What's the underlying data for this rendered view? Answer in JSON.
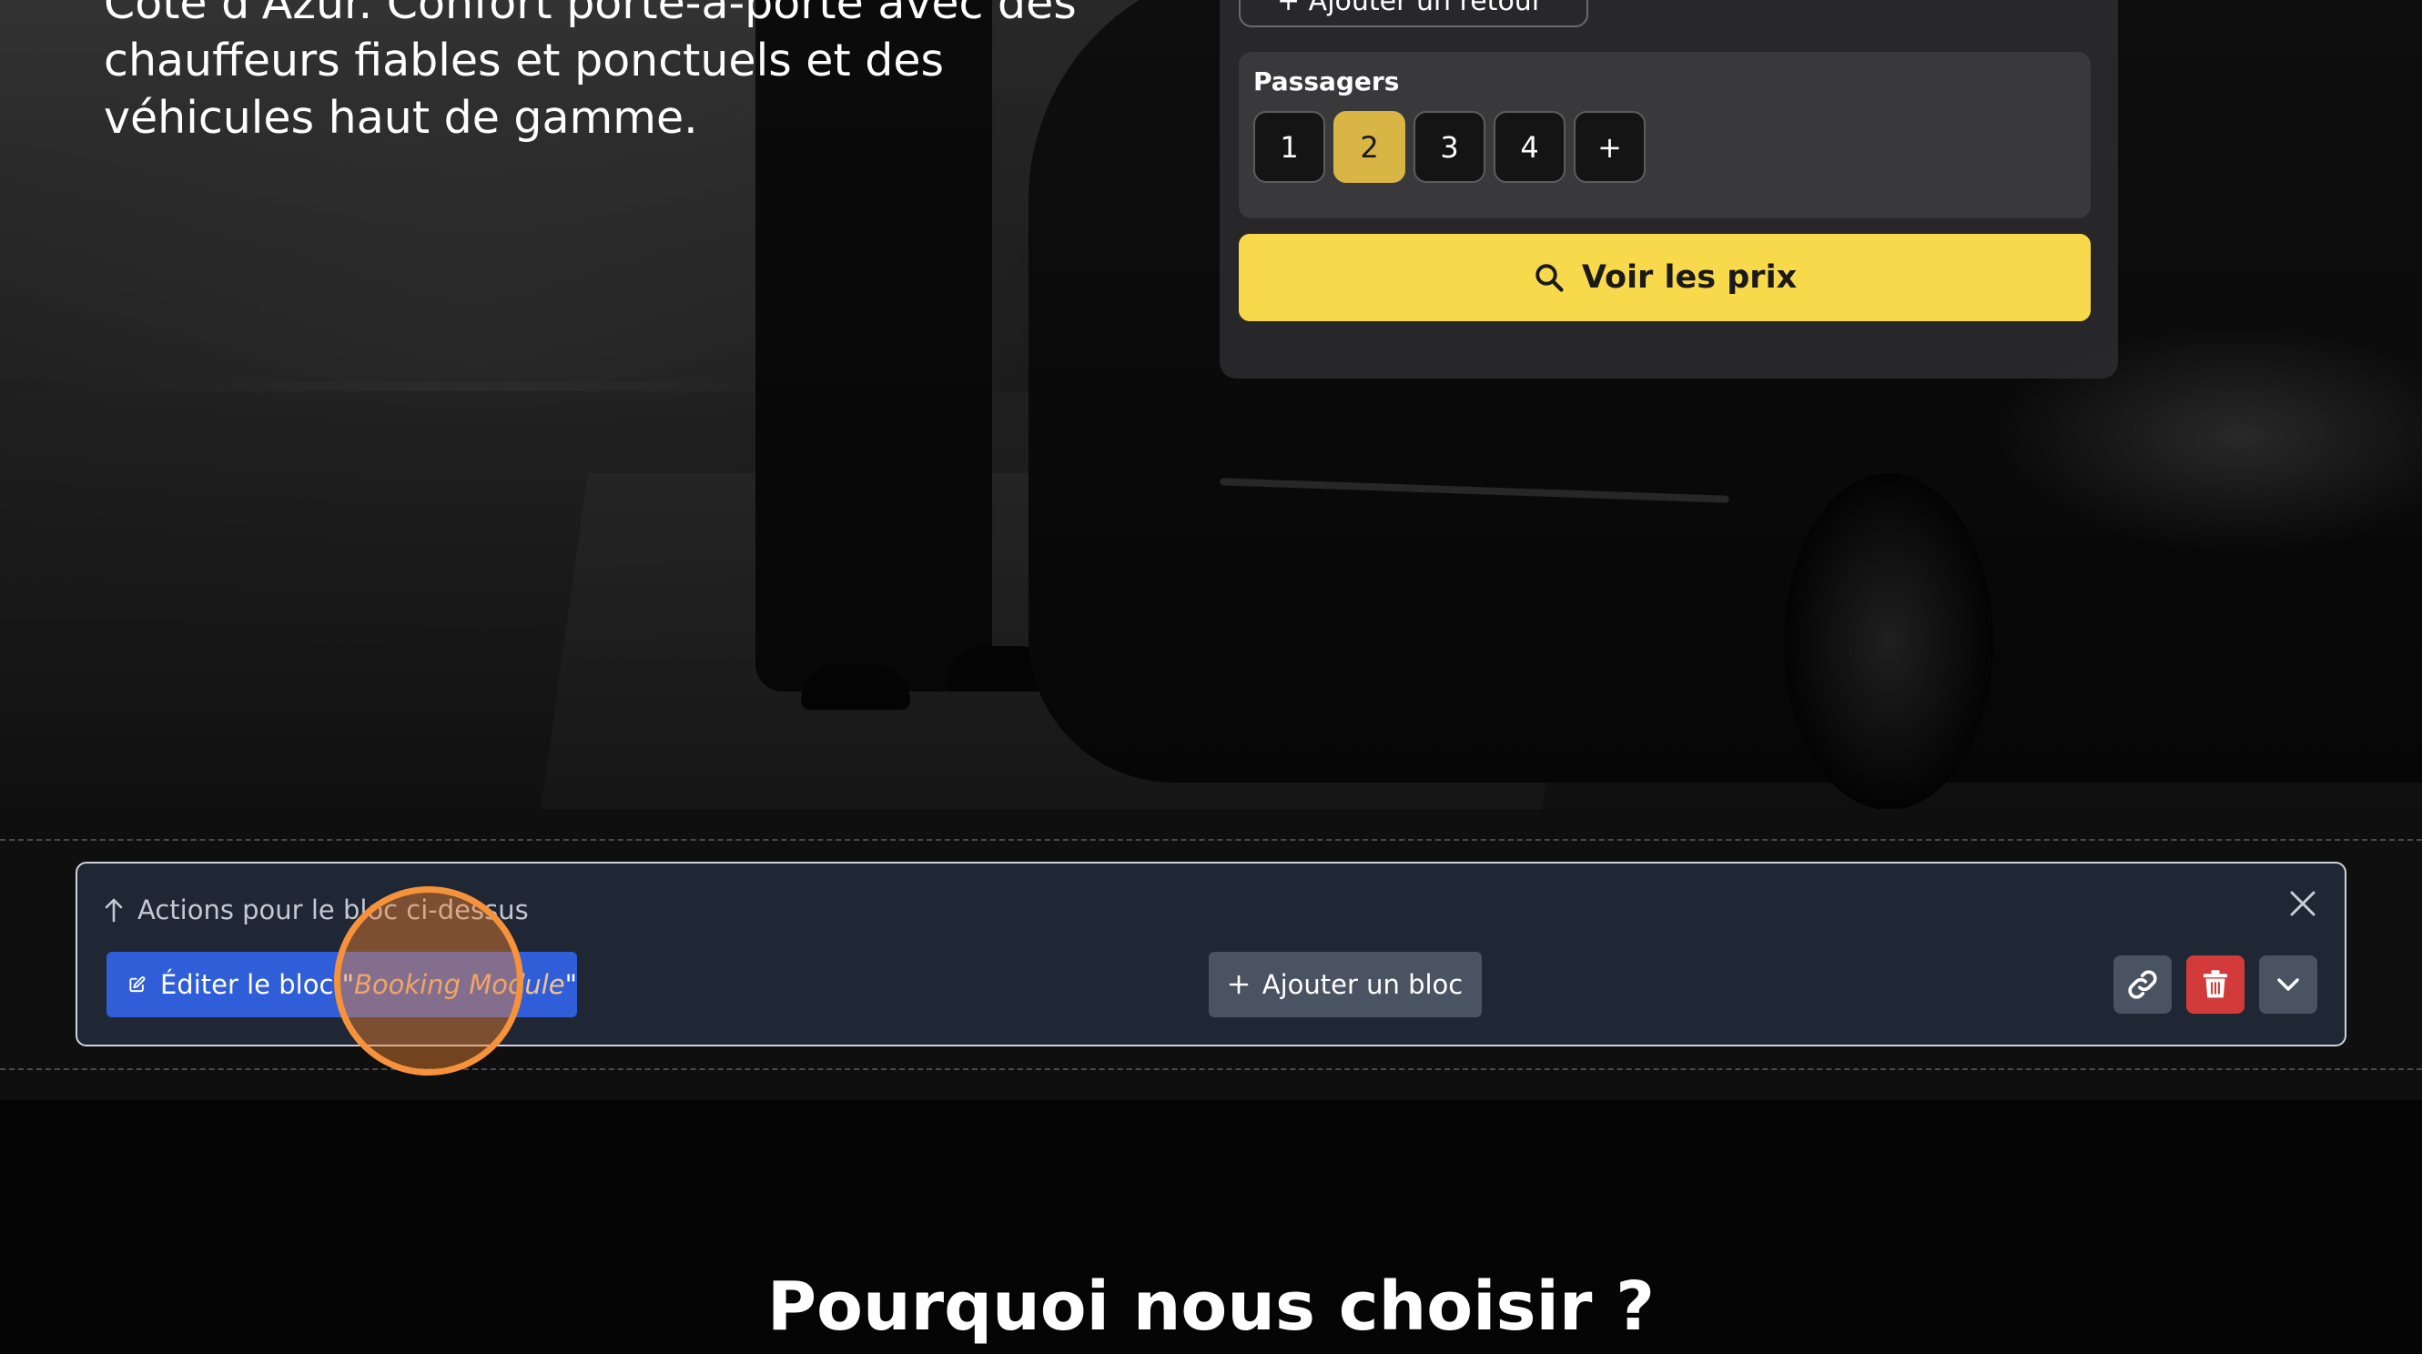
{
  "hero": {
    "lines": [
      "Côte d'Azur. Confort porte-à-porte avec des",
      "chauffeurs fiables et ponctuels et des",
      "véhicules haut de gamme."
    ]
  },
  "booking": {
    "return_label": "+ Ajouter un retour",
    "passengers_label": "Passagers",
    "passenger_options": [
      "1",
      "2",
      "3",
      "4",
      "+"
    ],
    "selected_passengers": "2",
    "search_label": "Voir les prix",
    "accent_color": "#f9d94c"
  },
  "actions": {
    "heading": "Actions pour le bloc ci-dessus",
    "edit_prefix": "Éditer le bloc \"",
    "block_name": "Booking Module",
    "edit_suffix": "\"",
    "add_label": "Ajouter un bloc",
    "icons": [
      "arrow-up-icon",
      "close-icon",
      "edit-icon",
      "plus-icon",
      "link-icon",
      "trash-icon",
      "chevron-down-icon"
    ],
    "delete_color": "#d33b3b",
    "edit_color": "#2f5ed8"
  },
  "why": {
    "title": "Pourquoi nous choisir ?"
  }
}
